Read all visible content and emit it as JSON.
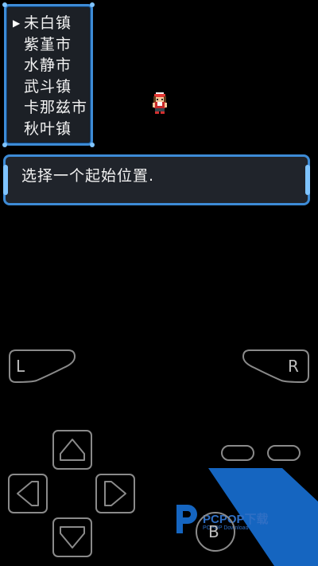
{
  "game": {
    "menu": {
      "cursor": "▶",
      "items": [
        "未白镇",
        "紫堇市",
        "水静市",
        "武斗镇",
        "卡那兹市",
        "秋叶镇"
      ],
      "selected_index": 0
    },
    "dialog": {
      "text": "选择一个起始位置."
    }
  },
  "controls": {
    "left_shoulder": "L",
    "right_shoulder": "R",
    "b_button": "B",
    "outline_color": "#8a8a8a",
    "ui_blue": "#3d8bd6"
  },
  "watermark": {
    "logo": "PCPOP下载",
    "sub": "PCPOP Download",
    "color": "#1565c0"
  }
}
